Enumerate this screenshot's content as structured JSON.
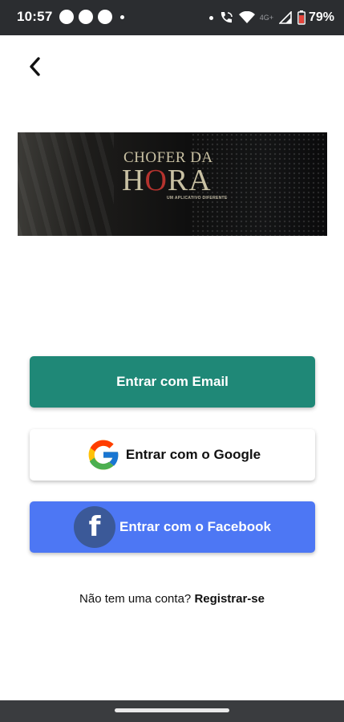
{
  "status_bar": {
    "time": "10:57",
    "network_label": "4G+",
    "battery_percent": "79%",
    "icons": [
      "notification-dot-icon",
      "notification-dot-icon",
      "notification-dot-icon",
      "more-dot-icon",
      "wifi-call-icon",
      "wifi-icon",
      "signal-icon",
      "battery-icon"
    ]
  },
  "header": {
    "back_icon": "chevron-left-icon"
  },
  "banner": {
    "brand_line1": "CHOFER DA",
    "brand_line2_pre": "H",
    "brand_line2_accent": "O",
    "brand_line2_post": "RA",
    "tagline": "UM APLICATIVO DIFERENTE"
  },
  "login": {
    "email_button": "Entrar com Email",
    "google_button": "Entrar com o Google",
    "facebook_button": "Entrar com o Facebook"
  },
  "signup": {
    "prompt": "Não tem uma conta?",
    "link": "Registrar-se"
  },
  "colors": {
    "email_button_bg": "#1f8877",
    "facebook_button_bg": "#4d77f4",
    "status_bar_bg": "#2b2d30"
  }
}
